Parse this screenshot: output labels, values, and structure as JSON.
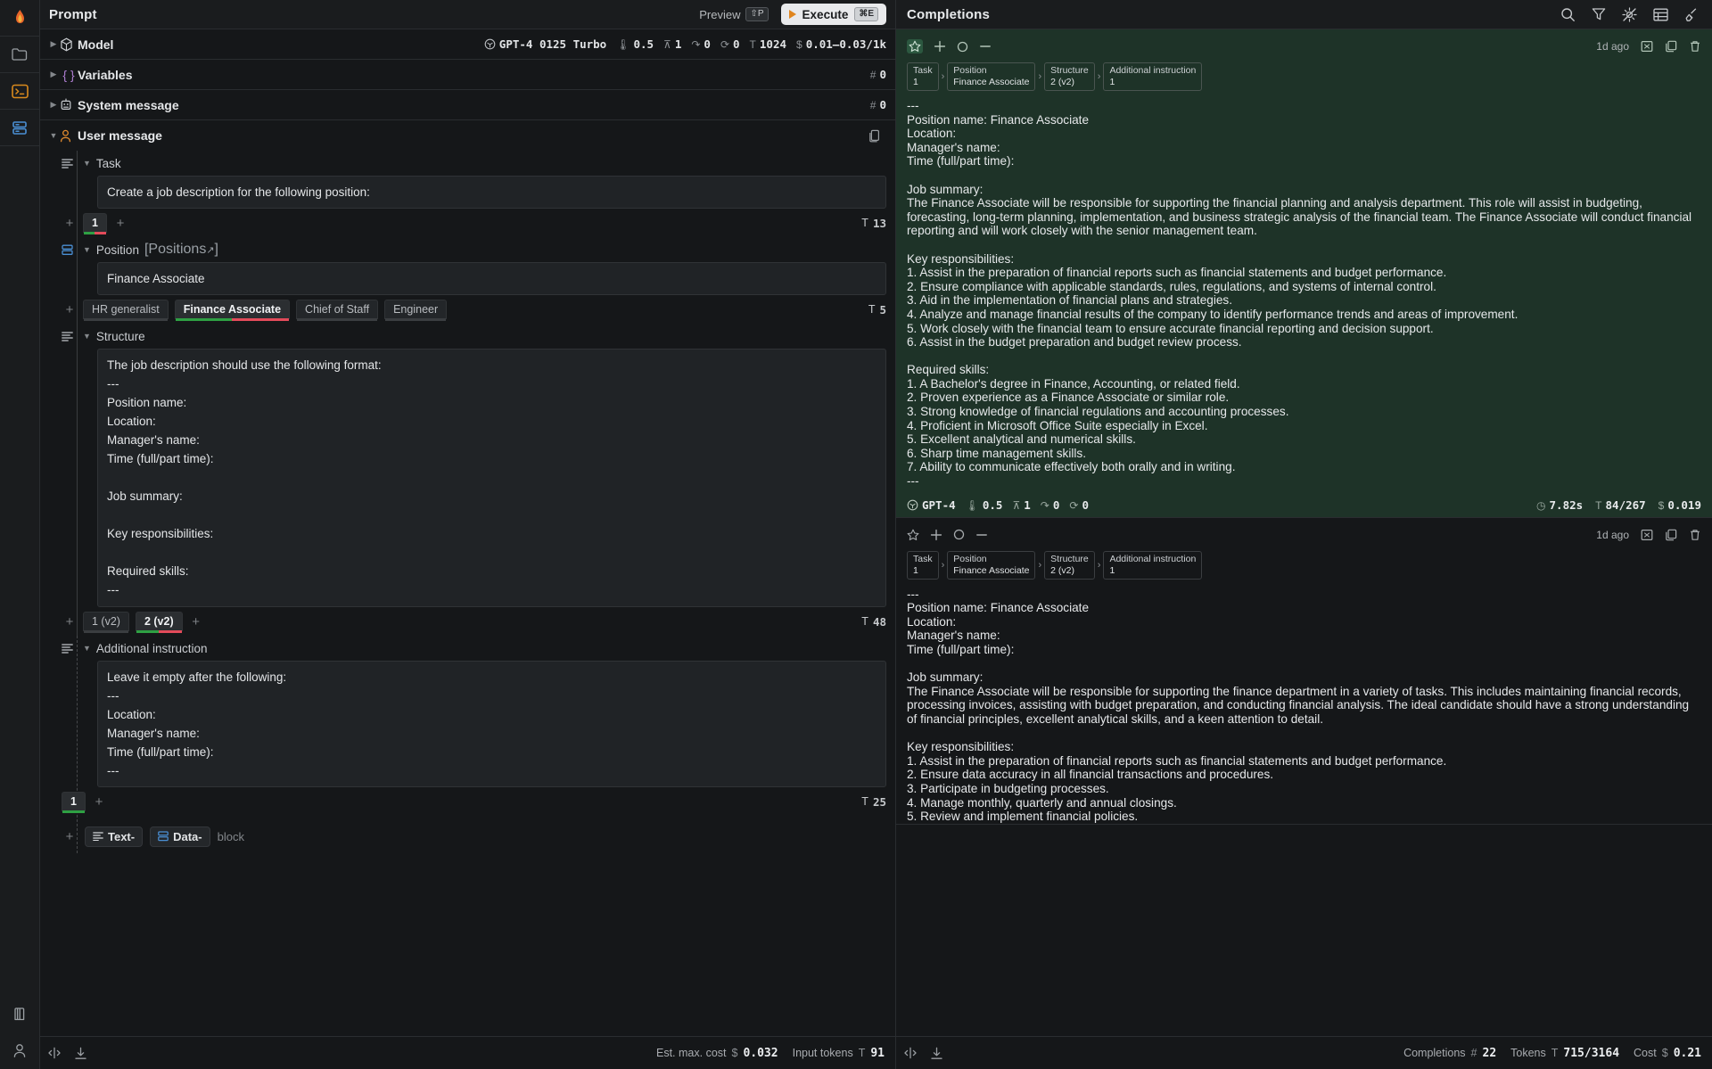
{
  "rail": {
    "items": [
      {
        "name": "app-logo",
        "icon": "flame-icon"
      },
      {
        "name": "files",
        "icon": "folder-icon"
      },
      {
        "name": "console",
        "icon": "terminal-icon"
      },
      {
        "name": "datasets",
        "icon": "database-icon"
      }
    ],
    "bottom": [
      {
        "name": "library",
        "icon": "library-icon"
      },
      {
        "name": "account",
        "icon": "user-icon"
      }
    ]
  },
  "prompt": {
    "title": "Prompt",
    "preview_label": "Preview",
    "preview_shortcut": "⇧P",
    "execute_label": "Execute",
    "execute_shortcut": "⌘E",
    "rows": [
      {
        "label": "Model",
        "icon": "cube-icon",
        "metrics": [
          {
            "icon": "openai-icon",
            "value": "GPT-4 0125 Turbo"
          },
          {
            "icon": "thermometer-icon",
            "value": "0.5"
          },
          {
            "icon": "top-p-icon",
            "value": "1"
          },
          {
            "icon": "presence-icon",
            "value": "0"
          },
          {
            "icon": "frequency-icon",
            "value": "0"
          },
          {
            "icon": "tokens-icon",
            "value": "1024"
          },
          {
            "icon": "cost-icon",
            "value": "0.01–0.03/1k"
          }
        ]
      },
      {
        "label": "Variables",
        "icon": "braces-icon",
        "metrics": [
          {
            "icon": "hash-icon",
            "value": "0"
          }
        ]
      },
      {
        "label": "System message",
        "icon": "robot-icon",
        "metrics": [
          {
            "icon": "hash-icon",
            "value": "0"
          }
        ]
      }
    ],
    "user_message": {
      "label": "User message",
      "icon": "person-icon",
      "copy_icon": "copy-icon",
      "blocks": [
        {
          "title": "Task",
          "type_icon": "text-block-icon",
          "content": "Create a job description for the following position:",
          "tabs": [
            {
              "label": "1",
              "active": true,
              "underline": "gr"
            }
          ],
          "token_icon": "tokens-icon",
          "token_count": "13"
        },
        {
          "title": "Position",
          "link": "Positions",
          "type_icon": "data-block-icon",
          "content": "Finance Associate",
          "tabs": [
            {
              "label": "HR generalist",
              "active": false,
              "underline": "dk"
            },
            {
              "label": "Finance Associate",
              "active": true,
              "underline": "gr"
            },
            {
              "label": "Chief of Staff",
              "active": false,
              "underline": "dk"
            },
            {
              "label": "Engineer",
              "active": false,
              "underline": "dk"
            }
          ],
          "token_icon": "tokens-icon",
          "token_count": "5"
        },
        {
          "title": "Structure",
          "type_icon": "text-block-icon",
          "content": "The job description should use the following format:\n---\nPosition name:\nLocation:\nManager's name:\nTime (full/part time):\n\nJob summary:\n\nKey responsibilities:\n\nRequired skills:\n---",
          "tabs": [
            {
              "label": "1 (v2)",
              "active": false,
              "underline": "dk"
            },
            {
              "label": "2 (v2)",
              "active": true,
              "underline": "gr"
            }
          ],
          "token_icon": "tokens-icon",
          "token_count": "48"
        },
        {
          "title": "Additional instruction",
          "type_icon": "text-block-icon",
          "content": "Leave it empty after the following:\n---\nLocation:\nManager's name:\nTime (full/part time):\n---",
          "tabs": [
            {
              "label": "1",
              "active": true,
              "underline": "g"
            }
          ],
          "token_icon": "tokens-icon",
          "token_count": "25"
        }
      ],
      "add_row": {
        "text_label": "Text-",
        "data_label": "Data-",
        "note": "block"
      }
    },
    "statusbar": {
      "left_icons": [
        "split-icon",
        "download-icon"
      ],
      "est_cost_label": "Est. max. cost",
      "est_cost_value": "0.032",
      "input_tokens_label": "Input tokens",
      "input_tokens_value": "91"
    }
  },
  "completions": {
    "title": "Completions",
    "header_icons": [
      "search-icon",
      "filter-icon",
      "sparkle-off-icon",
      "table-icon",
      "broom-icon"
    ],
    "cards": [
      {
        "starred": true,
        "actions": [
          "star-icon",
          "plus-icon",
          "circle-icon",
          "minus-icon"
        ],
        "ago": "1d ago",
        "meta_icons": [
          "export-icon",
          "duplicate-icon",
          "trash-icon"
        ],
        "crumbs": [
          {
            "line1": "Task",
            "line2": "1"
          },
          {
            "line1": "Position",
            "line2": "Finance Associate"
          },
          {
            "line1": "Structure",
            "line2": "2 (v2)"
          },
          {
            "line1": "Additional instruction",
            "line2": "1"
          }
        ],
        "body": "---\nPosition name: Finance Associate\nLocation:\nManager's name:\nTime (full/part time):\n\nJob summary:\nThe Finance Associate will be responsible for supporting the financial planning and analysis department. This role will assist in budgeting, forecasting, long-term planning, implementation, and business strategic analysis of the financial team. The Finance Associate will conduct financial reporting and will work closely with the senior management team.\n\nKey responsibilities:\n1. Assist in the preparation of financial reports such as financial statements and budget performance.\n2. Ensure compliance with applicable standards, rules, regulations, and systems of internal control.\n3. Aid in the implementation of financial plans and strategies.\n4. Analyze and manage financial results of the company to identify performance trends and areas of improvement.\n5. Work closely with the financial team to ensure accurate financial reporting and decision support.\n6. Assist in the budget preparation and budget review process.\n\nRequired skills:\n1. A Bachelor's degree in Finance, Accounting, or related field.\n2. Proven experience as a Finance Associate or similar role.\n3. Strong knowledge of financial regulations and accounting processes.\n4. Proficient in Microsoft Office Suite especially in Excel.\n5. Excellent analytical and numerical skills.\n6. Sharp time management skills.\n7. Ability to communicate effectively both orally and in writing.\n---",
        "footer_left": [
          {
            "icon": "openai-icon",
            "value": "GPT-4"
          },
          {
            "icon": "thermometer-icon",
            "value": "0.5"
          },
          {
            "icon": "top-p-icon",
            "value": "1"
          },
          {
            "icon": "presence-icon",
            "value": "0"
          },
          {
            "icon": "frequency-icon",
            "value": "0"
          }
        ],
        "footer_right": [
          {
            "icon": "clock-icon",
            "value": "7.82s"
          },
          {
            "icon": "tokens-icon",
            "value": "84/267"
          },
          {
            "icon": "cost-icon",
            "value": "0.019"
          }
        ]
      },
      {
        "starred": false,
        "actions": [
          "star-icon",
          "plus-icon",
          "circle-icon",
          "minus-icon"
        ],
        "ago": "1d ago",
        "meta_icons": [
          "export-icon",
          "duplicate-icon",
          "trash-icon"
        ],
        "crumbs": [
          {
            "line1": "Task",
            "line2": "1"
          },
          {
            "line1": "Position",
            "line2": "Finance Associate"
          },
          {
            "line1": "Structure",
            "line2": "2 (v2)"
          },
          {
            "line1": "Additional instruction",
            "line2": "1"
          }
        ],
        "body": "---\nPosition name: Finance Associate\nLocation:\nManager's name:\nTime (full/part time):\n\nJob summary:\nThe Finance Associate will be responsible for supporting the finance department in a variety of tasks. This includes maintaining financial records, processing invoices, assisting with budget preparation, and conducting financial analysis. The ideal candidate should have a strong understanding of financial principles, excellent analytical skills, and a keen attention to detail.\n\nKey responsibilities:\n1. Assist in the preparation of financial reports such as financial statements and budget performance.\n2. Ensure data accuracy in all financial transactions and procedures.\n3. Participate in budgeting processes.\n4. Manage monthly, quarterly and annual closings.\n5. Review and implement financial policies.",
        "footer_left": [],
        "footer_right": []
      }
    ],
    "statusbar": {
      "left_icons": [
        "split-icon",
        "download-icon"
      ],
      "completions_label": "Completions",
      "completions_value": "22",
      "tokens_label": "Tokens",
      "tokens_value": "715/3164",
      "cost_label": "Cost",
      "cost_value": "0.21"
    }
  },
  "colors": {
    "accent_orange": "#e0861f",
    "green": "#2ea043",
    "red": "#e34b5a",
    "card_green": "#1e3328",
    "blue": "#4a8fd4"
  }
}
